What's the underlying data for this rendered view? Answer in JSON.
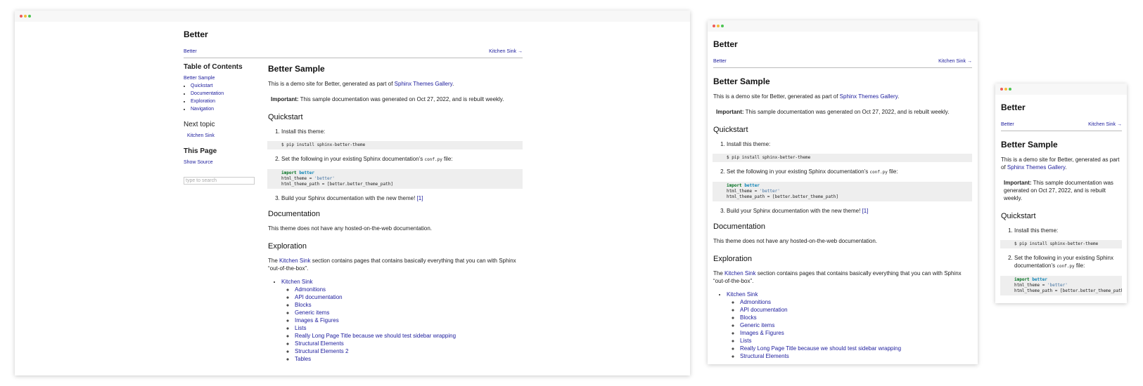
{
  "site_title": "Better",
  "relnav": {
    "left": "Better",
    "right": "Kitchen Sink →"
  },
  "page_title": "Better Sample",
  "intro": {
    "before": "This is a demo site for Better, generated as part of ",
    "link": "Sphinx Themes Gallery",
    "after": "."
  },
  "important": {
    "label": "Important:",
    "text": " This sample documentation was generated on Oct 27, 2022, and is rebuilt weekly."
  },
  "quickstart": {
    "heading": "Quickstart",
    "step1": "Install this theme:",
    "cmd": "$ pip install sphinx-better-theme",
    "step2_before": "Set the following in your existing Sphinx documentation’s ",
    "step2_code": "conf.py",
    "step2_after": " file:",
    "conf_kw": "import",
    "conf_mod": "better",
    "conf_line2_a": "html_theme = ",
    "conf_line2_b": "'better'",
    "conf_line3": "html_theme_path = [better.better_theme_path]",
    "step3": "Build your Sphinx documentation with the new theme! ",
    "step3_ref": "[1]"
  },
  "documentation": {
    "heading": "Documentation",
    "text": "This theme does not have any hosted-on-the-web documentation."
  },
  "exploration": {
    "heading": "Exploration",
    "before": "The ",
    "link": "Kitchen Sink",
    "after": " section contains pages that contains basically everything that you can with Sphinx “out-of-the-box”.",
    "top": "Kitchen Sink",
    "items": [
      "Admonitions",
      "API documentation",
      "Blocks",
      "Generic items",
      "Images & Figures",
      "Lists",
      "Really Long Page Title because we should test sidebar wrapping",
      "Structural Elements",
      "Structural Elements 2",
      "Tables"
    ],
    "items_w2": [
      "Admonitions",
      "API documentation",
      "Blocks",
      "Generic items",
      "Images & Figures",
      "Lists",
      "Really Long Page Title because we should test sidebar wrapping",
      "Structural Elements"
    ]
  },
  "sidebar": {
    "toc_title": "Table of Contents",
    "toc_top": "Better Sample",
    "toc_items": [
      "Quickstart",
      "Documentation",
      "Exploration",
      "Navigation"
    ],
    "next_heading": "Next topic",
    "next_link": "Kitchen Sink",
    "this_page": "This Page",
    "show_source": "Show Source",
    "search_placeholder": "type to search"
  },
  "colors": {
    "link": "#1c1c9c",
    "code_bg": "#eeeeee",
    "keyword": "#007020",
    "module": "#0e84b5",
    "string": "#4070a0"
  }
}
